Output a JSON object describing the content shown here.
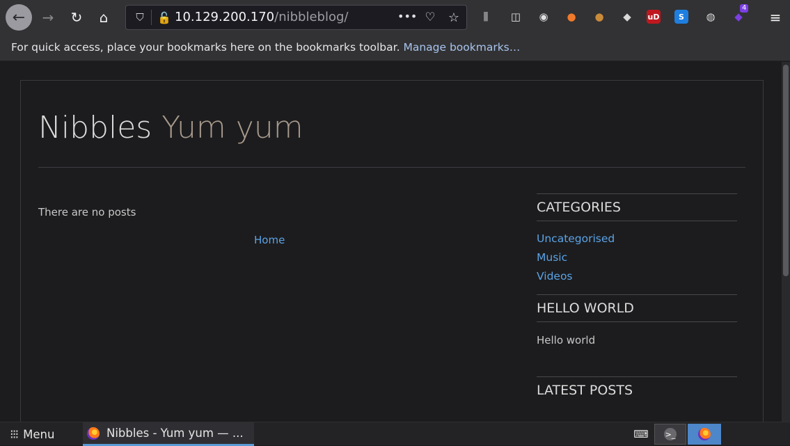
{
  "browser": {
    "url_host": "10.129.200.170",
    "url_path": "/nibbleblog/",
    "nav_icons": [
      "back-arrow-icon",
      "forward-arrow-icon",
      "reload-icon",
      "home-icon"
    ],
    "urlbar_icons": [
      "tracking-shield-icon",
      "insecure-lock-icon",
      "page-actions-icon",
      "pocket-icon",
      "bookmark-star-icon"
    ],
    "extension_badge": "4",
    "extensions": [
      {
        "name": "library-icon",
        "glyph": "⫼",
        "color": "#e0e0e4"
      },
      {
        "name": "sidebar-icon",
        "glyph": "◫",
        "color": "#e0e0e4"
      },
      {
        "name": "account-icon",
        "glyph": "◉",
        "color": "#e0e0e4"
      },
      {
        "name": "hackbar-icon",
        "glyph": "●",
        "color": "#f07a2b"
      },
      {
        "name": "cookie-icon",
        "glyph": "●",
        "color": "#c98b3a"
      },
      {
        "name": "wappalyzer-icon",
        "glyph": "◆",
        "color": "#d8d8d8"
      },
      {
        "name": "ublock-icon",
        "glyph": "uD",
        "color": "#c0171f"
      },
      {
        "name": "s-extension-icon",
        "glyph": "S",
        "color": "#1f7fe0"
      },
      {
        "name": "foxyproxy-icon",
        "glyph": "◍",
        "color": "#d8d8d8"
      },
      {
        "name": "extension-4-icon",
        "glyph": "◆",
        "color": "#7b3fe4"
      }
    ],
    "menu_icon": "hamburger-menu-icon"
  },
  "bookmarks_bar": {
    "message": "For quick access, place your bookmarks here on the bookmarks toolbar.",
    "manage_link": "Manage bookmarks…"
  },
  "page": {
    "site_title": "Nibbles",
    "site_slogan": "Yum yum",
    "no_posts_text": "There are no posts",
    "home_link": "Home",
    "sidebar": {
      "categories_title": "CATEGORIES",
      "categories": [
        "Uncategorised",
        "Music",
        "Videos"
      ],
      "hello_title": "HELLO WORLD",
      "hello_text": "Hello world",
      "latest_title": "LATEST POSTS"
    }
  },
  "taskbar": {
    "menu_label": "Menu",
    "task_title": "Nibbles - Yum yum — ..."
  },
  "colors": {
    "page_bg": "#1c1c1e",
    "link": "#5ba3e6",
    "slogan": "#a89a8c",
    "toolbar": "#323234",
    "active_task_accent": "#5b9bd5"
  }
}
